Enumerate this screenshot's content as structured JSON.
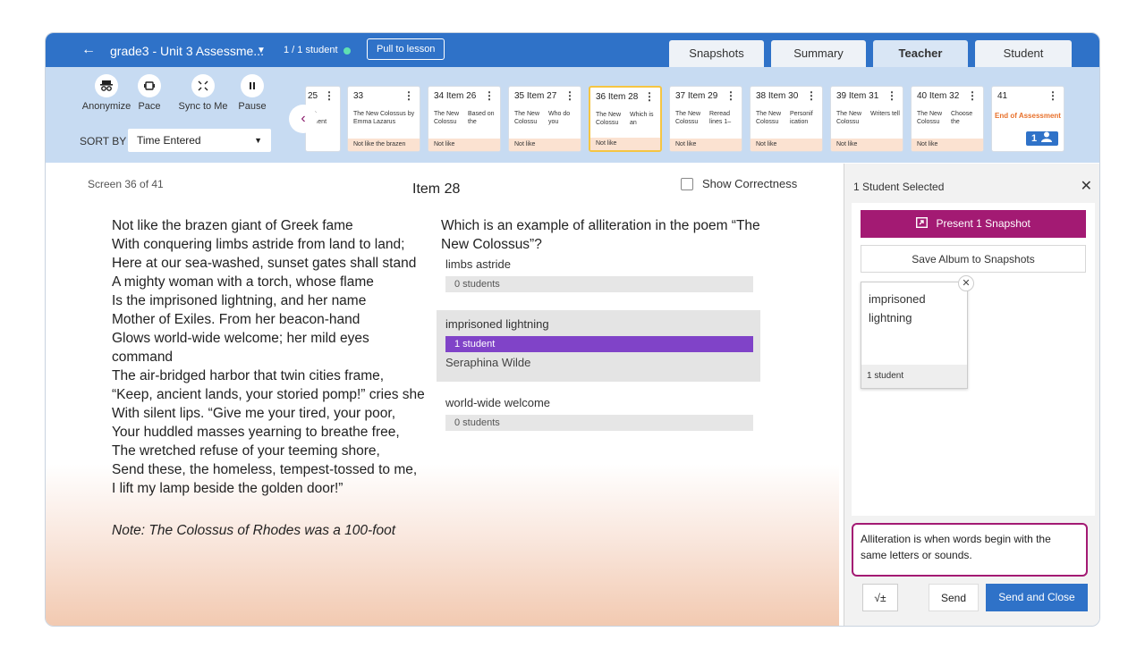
{
  "header": {
    "back_icon": "←",
    "lesson_title": "grade3 - Unit 3 Assessme...",
    "caret": "▼",
    "student_count": "1 / 1 student",
    "pull_button": "Pull to lesson",
    "tabs": [
      "Snapshots",
      "Summary",
      "Teacher",
      "Student"
    ],
    "active_tab": "Teacher"
  },
  "toolbar": {
    "controls": [
      {
        "icon": "incognito-icon",
        "glyph": "👓",
        "label": "Anonymize"
      },
      {
        "icon": "pace-icon",
        "glyph": "▭",
        "label": "Pace"
      },
      {
        "icon": "sync-icon",
        "glyph": "⤧",
        "label": "Sync to Me"
      },
      {
        "icon": "pause-icon",
        "glyph": "⏸",
        "label": "Pause"
      }
    ],
    "sort_label": "SORT BY",
    "sort_value": "Time Entered",
    "scroll_icon": "‹"
  },
  "cards": [
    {
      "header": "25",
      "col1": "hat lement",
      "col2": "",
      "foot": ""
    },
    {
      "header": "33",
      "col1": "The New Colossus by Emma Lazarus",
      "col2": "",
      "foot": "Not like the brazen"
    },
    {
      "header": "34 Item 26",
      "col1": "The New Colossu",
      "col2": "Based on the",
      "foot": "Not like"
    },
    {
      "header": "35 Item 27",
      "col1": "The New Colossu",
      "col2": "Who do you",
      "foot": "Not like"
    },
    {
      "header": "36 Item 28",
      "col1": "The New Colossu",
      "col2": "Which is an",
      "foot": "Not like"
    },
    {
      "header": "37 Item 29",
      "col1": "The New Colossu",
      "col2": "Reread lines 1–",
      "foot": "Not like"
    },
    {
      "header": "38 Item 30",
      "col1": "The New Colossu",
      "col2": "Personif ication",
      "foot": "Not like"
    },
    {
      "header": "39 Item 31",
      "col1": "The New Colossu",
      "col2": "Writers tell",
      "foot": "Not like"
    },
    {
      "header": "40 Item 32",
      "col1": "The New Colossu",
      "col2": "Choose the",
      "foot": "Not like"
    },
    {
      "header": "41",
      "col1": "",
      "col2": "",
      "foot": "",
      "end_text": "End of Assessment",
      "badge": "1"
    }
  ],
  "main": {
    "screen_num": "Screen 36 of 41",
    "item_title": "Item 28",
    "show_correctness": "Show Correctness",
    "poem_lines": [
      "Not like the brazen giant of Greek fame",
      "With conquering limbs astride from land to land;",
      "Here at our sea-washed, sunset gates shall stand",
      "A mighty woman with a torch, whose flame",
      "Is the imprisoned lightning, and her name",
      "Mother of Exiles. From her beacon-hand",
      "Glows world-wide welcome; her mild eyes command",
      "The air-bridged harbor that twin cities frame,",
      "“Keep, ancient lands, your storied pomp!” cries she",
      "With silent lips. “Give me your tired, your poor,",
      "Your huddled masses yearning to breathe free,",
      "The wretched refuse of your teeming shore,",
      "Send these, the homeless, tempest-tossed to me,",
      "I lift my lamp beside the golden door!”"
    ],
    "poem_note": "Note: The Colossus of Rhodes was a 100-foot",
    "question": "Which is an example of alliteration in the poem “The New Colossus”?",
    "answers": [
      {
        "text": "limbs astride",
        "count": "0 students",
        "selected": false,
        "student": ""
      },
      {
        "text": "imprisoned lightning",
        "count": "1 student",
        "selected": true,
        "student": "Seraphina Wilde"
      },
      {
        "text": "world-wide welcome",
        "count": "0 students",
        "selected": false,
        "student": ""
      }
    ]
  },
  "panel": {
    "title": "1 Student Selected",
    "close_icon": "✕",
    "present_button": "Present 1 Snapshot",
    "album_button": "Save Album to Snapshots",
    "snapshot": {
      "text_line1": "imprisoned",
      "text_line2": "lightning",
      "footer": "1 student"
    },
    "message": "Alliteration is when words begin with the same letters or sounds.",
    "math_button": "√±",
    "send_button": "Send",
    "send_close_button": "Send and Close"
  },
  "colors": {
    "accent_blue": "#2f72c8",
    "magenta": "#a31a73",
    "purple_bar": "#8043c8",
    "selected_card": "#f5c542"
  }
}
